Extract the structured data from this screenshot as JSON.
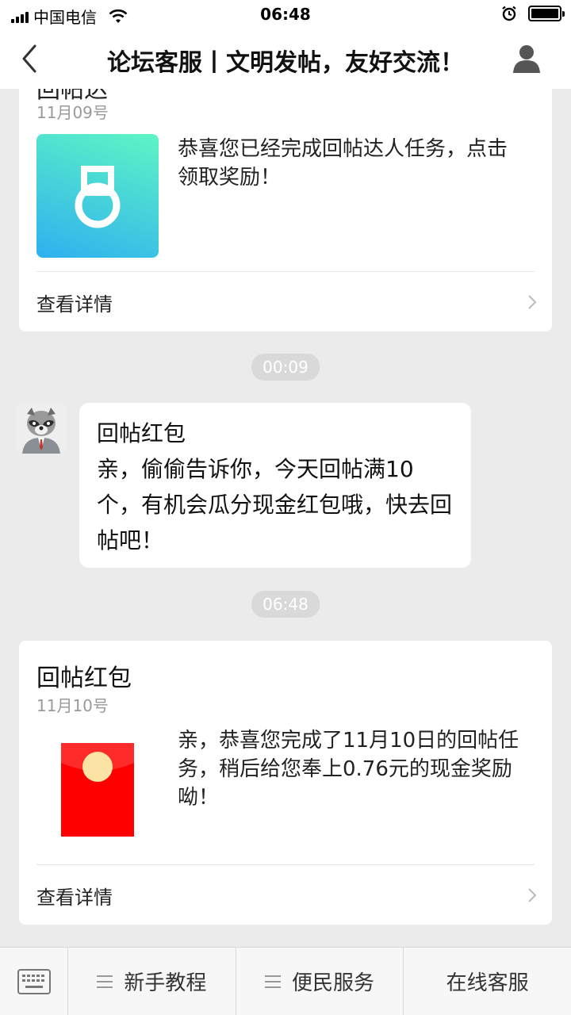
{
  "status_bar": {
    "carrier": "中国电信",
    "time": "06:48"
  },
  "nav": {
    "title": "论坛客服丨文明发帖，友好交流！"
  },
  "cards": [
    {
      "partial_title": "回帖达",
      "date": "11月09号",
      "text": "恭喜您已经完成回帖达人任务，点击领取奖励！",
      "link": "查看详情",
      "thumb_colors": [
        "#2fb0f0",
        "#5ef5c4"
      ]
    },
    {
      "title": "回帖红包",
      "date": "11月10号",
      "text": "亲，恭喜您完成了11月10日的回帖任务，稍后给您奉上0.76元的现金奖励呦！",
      "link": "查看详情"
    }
  ],
  "timestamps": [
    "00:09",
    "06:48"
  ],
  "message": {
    "title": "回帖红包",
    "text": "亲，偷偷告诉你，今天回帖满10个，有机会瓜分现金红包哦，快去回帖吧！"
  },
  "bottom_menu": {
    "items": [
      "新手教程",
      "便民服务",
      "在线客服"
    ]
  },
  "colors": {
    "red_packet": "#ff0000",
    "red_packet_coin": "#fbe3a6",
    "background": "#ebebeb"
  }
}
